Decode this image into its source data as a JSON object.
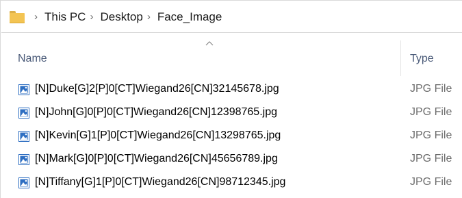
{
  "address_bar": {
    "folder_icon": "folder-icon",
    "separator_icon": "chevron-right-icon",
    "breadcrumbs": [
      "This PC",
      "Desktop",
      "Face_Image"
    ]
  },
  "columns": {
    "sort_indicator_icon": "sort-ascending-caret-icon",
    "name": "Name",
    "type": "Type"
  },
  "files": [
    {
      "name": "[N]Duke[G]2[P]0[CT]Wiegand26[CN]32145678.jpg",
      "type": "JPG File",
      "icon": "image-file-icon"
    },
    {
      "name": "[N]John[G]0[P]0[CT]Wiegand26[CN]12398765.jpg",
      "type": "JPG File",
      "icon": "image-file-icon"
    },
    {
      "name": "[N]Kevin[G]1[P]0[CT]Wiegand26[CN]13298765.jpg",
      "type": "JPG File",
      "icon": "image-file-icon"
    },
    {
      "name": "[N]Mark[G]0[P]0[CT]Wiegand26[CN]45656789.jpg",
      "type": "JPG File",
      "icon": "image-file-icon"
    },
    {
      "name": "[N]Tiffany[G]1[P]0[CT]Wiegand26[CN]98712345.jpg",
      "type": "JPG File",
      "icon": "image-file-icon"
    }
  ],
  "colors": {
    "folder": "#f3c453",
    "header_text": "#4a5a78",
    "type_text": "#6d6d6d",
    "icon_blue": "#2f6fc2"
  }
}
